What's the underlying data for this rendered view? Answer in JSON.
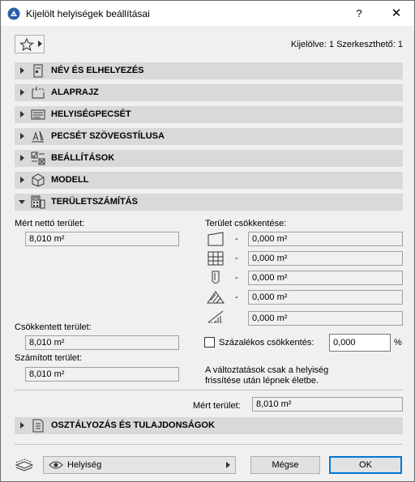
{
  "window": {
    "title": "Kijelölt helyiségek beállításai",
    "help_label": "?",
    "close_label": "✕"
  },
  "toolbar": {
    "favorites_icon": "star-icon",
    "selection_info": "Kijelölve: 1 Szerkeszthető: 1"
  },
  "sections": [
    {
      "title": "NÉV ÉS ELHELYEZÉS",
      "icon": "name-position-icon",
      "expanded": false
    },
    {
      "title": "ALAPRAJZ",
      "icon": "floor-plan-icon",
      "expanded": false
    },
    {
      "title": "HELYISÉGPECSÉT",
      "icon": "zone-stamp-icon",
      "expanded": false
    },
    {
      "title": "PECSÉT SZÖVEGSTÍLUSA",
      "icon": "text-style-icon",
      "expanded": false
    },
    {
      "title": "BEÁLLÍTÁSOK",
      "icon": "settings-icon",
      "expanded": false
    },
    {
      "title": "MODELL",
      "icon": "model-icon",
      "expanded": false
    },
    {
      "title": "TERÜLETSZÁMÍTÁS",
      "icon": "area-calculation-icon",
      "expanded": true
    }
  ],
  "area": {
    "measured_net_label": "Mért nettó terület:",
    "measured_net_value": "8,010 m²",
    "reduced_label": "Csökkentett terület:",
    "reduced_value": "8,010 m²",
    "calculated_label": "Számított terület:",
    "calculated_value": "8,010 m²",
    "reductions_label": "Terület csökkentése:",
    "reductions": [
      {
        "icon": "low-ceiling-icon",
        "dash": "-",
        "value": "0,000 m²"
      },
      {
        "icon": "wall-inset-icon",
        "dash": "-",
        "value": "0,000 m²"
      },
      {
        "icon": "column-icon",
        "dash": "-",
        "value": "0,000 m²"
      },
      {
        "icon": "fill-icon",
        "dash": "-",
        "value": "0,000 m²"
      },
      {
        "icon": "sloped-area-icon",
        "dash": "-",
        "value": "0,000 m²"
      }
    ],
    "percent_label": "Százalékos csökkentés:",
    "percent_value": "0,000",
    "percent_unit": "%",
    "note_line1": "A változtatások csak a helyiség",
    "note_line2": "frissítése után lépnek életbe.",
    "measured_area_label": "Mért terület:",
    "measured_area_value": "8,010 m²"
  },
  "classification": {
    "title": "OSZTÁLYOZÁS ÉS TULAJDONSÁGOK",
    "icon": "classification-icon"
  },
  "footer": {
    "layer_icon": "layer-icon",
    "view_icon": "eye-icon",
    "dropdown_value": "Helyiség",
    "cancel_label": "Mégse",
    "ok_label": "OK"
  }
}
